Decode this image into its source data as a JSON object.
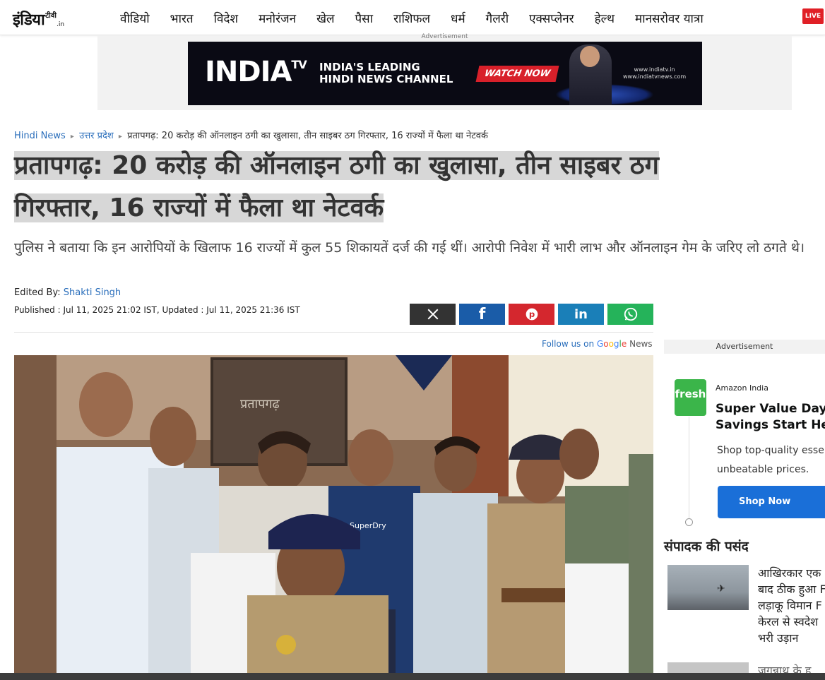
{
  "site": {
    "logo_main": "इंडिया",
    "logo_tv": "टीवी",
    "logo_domain": ".in",
    "live_label": "LIVE"
  },
  "nav": {
    "items": [
      "वीडियो",
      "भारत",
      "विदेश",
      "मनोरंजन",
      "खेल",
      "पैसा",
      "राशिफल",
      "धर्म",
      "गैलरी",
      "एक्सप्लेनर",
      "हेल्थ",
      "मानसरोवर यात्रा"
    ]
  },
  "ad_banner": {
    "label": "Advertisement",
    "logo_left": "INDIA",
    "logo_tv": "TV",
    "tagline_line1": "INDIA'S LEADING",
    "tagline_line2": "HINDI NEWS CHANNEL",
    "cta": "WATCH NOW",
    "url_line1": "www.indiatv.in",
    "url_line2": "www.indiatvnews.com"
  },
  "breadcrumb": {
    "home": "Hindi News",
    "section": "उत्तर प्रदेश",
    "current": "प्रतापगढ़: 20 करोड़ की ऑनलाइन ठगी का खुलासा, तीन साइबर ठग गिरफ्तार, 16 राज्यों में फैला था नेटवर्क"
  },
  "article": {
    "headline_line1": "प्रतापगढ़: 20 करोड़ की ऑनलाइन ठगी का खुलासा, तीन साइबर ठग",
    "headline_line2": "गिरफ्तार, 16 राज्यों में फैला था नेटवर्क",
    "summary": "पुलिस ने बताया कि इन आरोपियों के खिलाफ 16 राज्यों में कुल 55 शिकायतें दर्ज की गई थीं। आरोपी निवेश में भारी लाभ और ऑनलाइन गेम के जरिए लो ठगते थे।",
    "edited_by_label": "Edited By:",
    "editor": "Shakti Singh",
    "published": "Published : Jul 11, 2025 21:02 IST, Updated : Jul 11, 2025 21:36 IST",
    "sign_text": "प्रतापगढ़",
    "jersey_text": "SuperDry"
  },
  "share": {
    "x": "X",
    "facebook": "f",
    "pinterest": "P",
    "linkedin": "in",
    "whatsapp": "W",
    "colors": {
      "x": "#333333",
      "facebook": "#1a5ca8",
      "pinterest": "#d4272e",
      "linkedin": "#1a7fb8",
      "whatsapp": "#25b35a"
    }
  },
  "follow": {
    "prefix": "Follow us on",
    "google": "Google",
    "news": "News"
  },
  "side_ad": {
    "label": "Advertisement",
    "logo": "fresh",
    "advertiser": "Amazon India",
    "title_line1": "Super Value Days: S",
    "title_line2": "Savings Start Here!",
    "body_line1": "Shop top-quality essen",
    "body_line2": "unbeatable prices.",
    "cta": "Shop Now"
  },
  "editors_pick": {
    "title": "संपादक की पसंद",
    "item1_lines": [
      "आखिरकार एक",
      "बाद ठीक हुआ F",
      "लड़ाकू विमान F",
      "केरल से स्वदेश",
      "भरी उड़ान"
    ],
    "item2_text": "जगन्नाथ के ह"
  }
}
